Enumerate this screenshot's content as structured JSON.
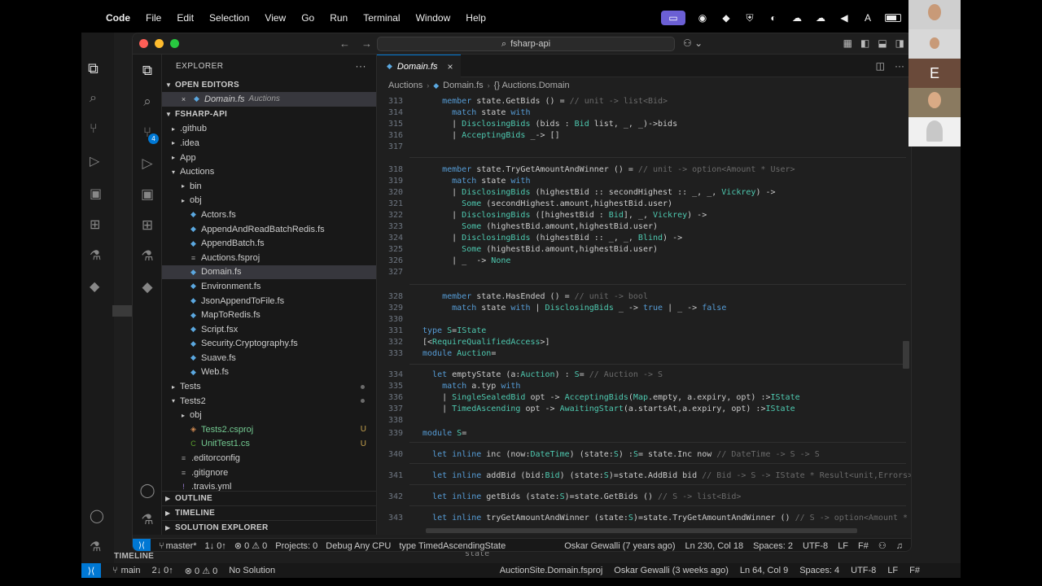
{
  "menubar": {
    "app_name": "Code",
    "items": [
      "File",
      "Edit",
      "Selection",
      "View",
      "Go",
      "Run",
      "Terminal",
      "Window",
      "Help"
    ]
  },
  "window": {
    "search_text": "fsharp-api"
  },
  "explorer": {
    "title": "EXPLORER",
    "open_editors_label": "OPEN EDITORS",
    "open_editor": {
      "name": "Domain.fs",
      "desc": "Auctions"
    },
    "project_label": "FSHARP-API",
    "tree": [
      {
        "name": ".github",
        "type": "folder",
        "level": 1
      },
      {
        "name": ".idea",
        "type": "folder",
        "level": 1
      },
      {
        "name": "App",
        "type": "folder",
        "level": 1
      },
      {
        "name": "Auctions",
        "type": "folder-open",
        "level": 1
      },
      {
        "name": "bin",
        "type": "folder",
        "level": 2
      },
      {
        "name": "obj",
        "type": "folder",
        "level": 2
      },
      {
        "name": "Actors.fs",
        "type": "fs",
        "level": 2
      },
      {
        "name": "AppendAndReadBatchRedis.fs",
        "type": "fs",
        "level": 2
      },
      {
        "name": "AppendBatch.fs",
        "type": "fs",
        "level": 2
      },
      {
        "name": "Auctions.fsproj",
        "type": "proj",
        "level": 2
      },
      {
        "name": "Domain.fs",
        "type": "fs",
        "level": 2,
        "selected": true
      },
      {
        "name": "Environment.fs",
        "type": "fs",
        "level": 2
      },
      {
        "name": "JsonAppendToFile.fs",
        "type": "fs",
        "level": 2
      },
      {
        "name": "MapToRedis.fs",
        "type": "fs",
        "level": 2
      },
      {
        "name": "Script.fsx",
        "type": "fs",
        "level": 2
      },
      {
        "name": "Security.Cryptography.fs",
        "type": "fs",
        "level": 2
      },
      {
        "name": "Suave.fs",
        "type": "fs",
        "level": 2
      },
      {
        "name": "Web.fs",
        "type": "fs",
        "level": 2
      },
      {
        "name": "Tests",
        "type": "folder",
        "level": 1,
        "dot": true
      },
      {
        "name": "Tests2",
        "type": "folder-open",
        "level": 1,
        "dot": true
      },
      {
        "name": "obj",
        "type": "folder",
        "level": 2
      },
      {
        "name": "Tests2.csproj",
        "type": "csproj",
        "level": 2,
        "git": "U"
      },
      {
        "name": "UnitTest1.cs",
        "type": "cs",
        "level": 2,
        "git": "U"
      },
      {
        "name": ".editorconfig",
        "type": "config",
        "level": 1
      },
      {
        "name": ".gitignore",
        "type": "config",
        "level": 1
      },
      {
        "name": ".travis.yml",
        "type": "yml",
        "level": 1
      }
    ],
    "outline_label": "OUTLINE",
    "timeline_label": "TIMELINE",
    "solution_label": "SOLUTION EXPLORER"
  },
  "editor": {
    "tab_name": "Domain.fs",
    "breadcrumbs": [
      "Auctions",
      "Domain.fs",
      "{} Auctions.Domain"
    ]
  },
  "code_lines": [
    {
      "n": "313",
      "t": "    member state.GetBids () = // unit -> list<Bid>"
    },
    {
      "n": "314",
      "t": "      match state with"
    },
    {
      "n": "315",
      "t": "      | DisclosingBids (bids : Bid list, _, _)->bids"
    },
    {
      "n": "316",
      "t": "      | AcceptingBids _-> []"
    },
    {
      "n": "317",
      "t": ""
    },
    {
      "n": "318",
      "t": "    member state.TryGetAmountAndWinner () = // unit -> option<Amount * User>"
    },
    {
      "n": "319",
      "t": "      match state with"
    },
    {
      "n": "320",
      "t": "      | DisclosingBids (highestBid :: secondHighest :: _, _, Vickrey) ->"
    },
    {
      "n": "321",
      "t": "        Some (secondHighest.amount,highestBid.user)"
    },
    {
      "n": "322",
      "t": "      | DisclosingBids ([highestBid : Bid], _, Vickrey) ->"
    },
    {
      "n": "323",
      "t": "        Some (highestBid.amount,highestBid.user)"
    },
    {
      "n": "324",
      "t": "      | DisclosingBids (highestBid :: _, _, Blind) ->"
    },
    {
      "n": "325",
      "t": "        Some (highestBid.amount,highestBid.user)"
    },
    {
      "n": "326",
      "t": "      | _  -> None"
    },
    {
      "n": "327",
      "t": ""
    },
    {
      "n": "328",
      "t": "    member state.HasEnded () = // unit -> bool"
    },
    {
      "n": "329",
      "t": "      match state with | DisclosingBids _ -> true | _ -> false"
    },
    {
      "n": "330",
      "t": ""
    },
    {
      "n": "331",
      "t": "type S=IState"
    },
    {
      "n": "332",
      "t": "[<RequireQualifiedAccess>]"
    },
    {
      "n": "333",
      "t": "module Auction="
    },
    {
      "n": "334",
      "t": "  let emptyState (a:Auction) : S= // Auction -> S"
    },
    {
      "n": "335",
      "t": "    match a.typ with"
    },
    {
      "n": "336",
      "t": "    | SingleSealedBid opt -> AcceptingBids(Map.empty, a.expiry, opt) :>IState"
    },
    {
      "n": "337",
      "t": "    | TimedAscending opt -> AwaitingStart(a.startsAt,a.expiry, opt) :>IState"
    },
    {
      "n": "338",
      "t": ""
    },
    {
      "n": "339",
      "t": "module S="
    },
    {
      "n": "340",
      "t": "  let inline inc (now:DateTime) (state:S) :S= state.Inc now // DateTime -> S -> S"
    },
    {
      "n": "341",
      "t": "  let inline addBid (bid:Bid) (state:S)=state.AddBid bid // Bid -> S -> IState * Result<unit,Errors>"
    },
    {
      "n": "342",
      "t": "  let inline getBids (state:S)=state.GetBids () // S -> list<Bid>"
    },
    {
      "n": "343",
      "t": "  let inline tryGetAmountAndWinner (state:S)=state.TryGetAmountAndWinner () // S -> option<Amount * User>"
    }
  ],
  "statusbar": {
    "branch": "master*",
    "sync": "1↓ 0↑",
    "problems": "⊗ 0 ⚠ 0",
    "projects": "Projects: 0",
    "config": "Debug Any CPU",
    "type_info": "type TimedAscendingState",
    "blame": "Oskar Gewalli (7 years ago)",
    "position": "Ln 230, Col 18",
    "spaces": "Spaces: 2",
    "encoding": "UTF-8",
    "eol": "LF",
    "language": "F#"
  },
  "back_status": {
    "branch": "main",
    "sync": "2↓ 0↑",
    "problems": "⊗ 0 ⚠ 0",
    "solution": "No Solution",
    "project": "AuctionSite.Domain.fsproj",
    "blame": "Oskar Gewalli (3 weeks ago)",
    "position": "Ln 64, Col 9",
    "spaces": "Spaces: 4",
    "encoding": "UTF-8",
    "eol": "LF",
    "language": "F#"
  },
  "back_window": {
    "timeline_label": "TIMELINE",
    "state_text": "state"
  },
  "video_participants": [
    {
      "letter": ""
    },
    {
      "letter": ""
    },
    {
      "letter": "E"
    },
    {
      "letter": ""
    },
    {
      "letter": ""
    }
  ]
}
